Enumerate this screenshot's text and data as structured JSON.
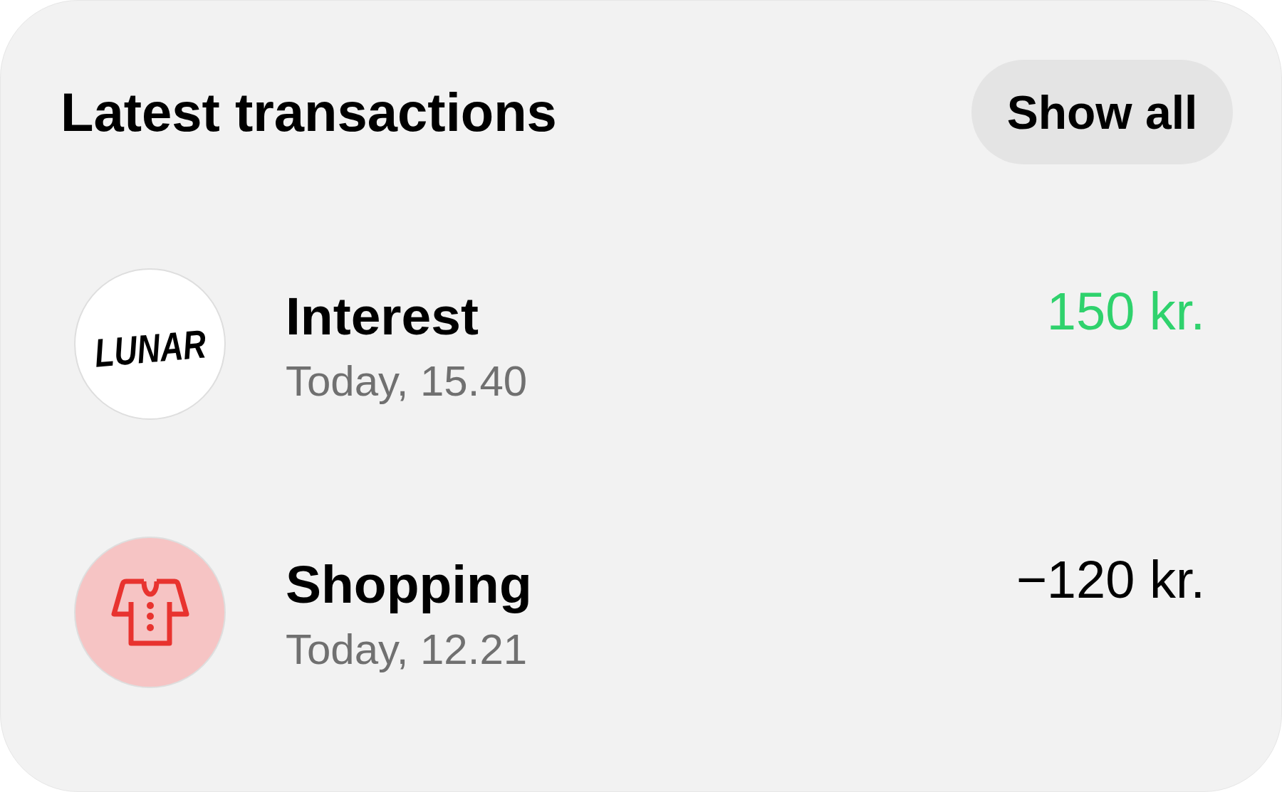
{
  "header": {
    "title": "Latest transactions",
    "button": "Show all"
  },
  "transactions": [
    {
      "kind": "logo",
      "logo": "LUNAR",
      "name": "Interest",
      "time": "Today, 15.40",
      "amount": "150 kr.",
      "incoming": true
    },
    {
      "kind": "category",
      "name": "Shopping",
      "time": "Today, 12.21",
      "amount": "−120 kr.",
      "incoming": false
    }
  ]
}
